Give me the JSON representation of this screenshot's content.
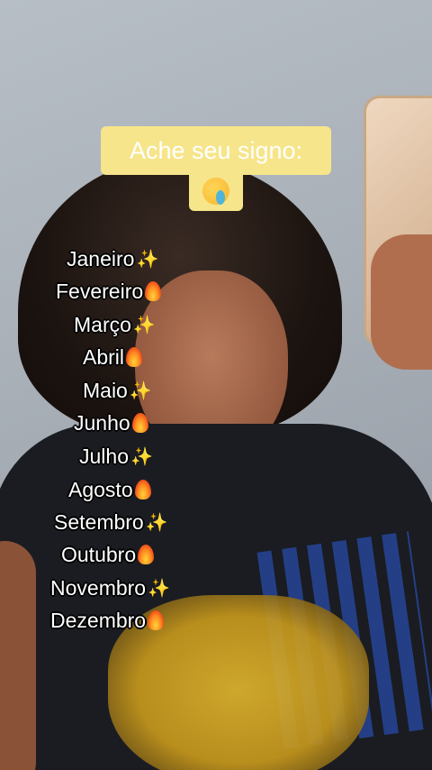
{
  "title": "Ache seu signo:",
  "months": [
    {
      "name": "Janeiro",
      "icon": "sparkle"
    },
    {
      "name": "Fevereiro",
      "icon": "fire"
    },
    {
      "name": "Março",
      "icon": "sparkle"
    },
    {
      "name": "Abril",
      "icon": "fire"
    },
    {
      "name": "Maio",
      "icon": "sparkle"
    },
    {
      "name": "Junho",
      "icon": "fire"
    },
    {
      "name": "Julho",
      "icon": "sparkle"
    },
    {
      "name": "Agosto",
      "icon": "fire"
    },
    {
      "name": "Setembro",
      "icon": "sparkle"
    },
    {
      "name": "Outubro",
      "icon": "fire"
    },
    {
      "name": "Novembro",
      "icon": "sparkle"
    },
    {
      "name": "Dezembro",
      "icon": "fire"
    }
  ]
}
